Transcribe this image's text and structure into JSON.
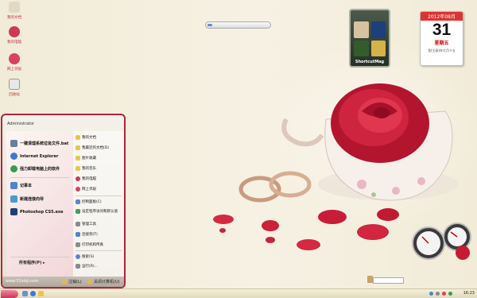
{
  "desktop": {
    "icons": [
      {
        "label": "我的文档",
        "color": "#d4c8b0"
      },
      {
        "label": "我的电脑",
        "color": "#cc3a55"
      },
      {
        "label": "网上邻居",
        "color": "#d9415f"
      },
      {
        "label": "回收站",
        "color": "#e8e8e8"
      }
    ]
  },
  "widgets": {
    "shortcut_caption": "ShortcutMag",
    "calendar": {
      "month_header": "2012年08月",
      "day": "31",
      "weekday": "星期五",
      "lunar": "龙(壬辰)年七月十五"
    }
  },
  "start_menu": {
    "user": "Administrator",
    "left_items": [
      {
        "label": "一键清理系统垃圾文件.bat",
        "color": "#6a7f9a"
      },
      {
        "label": "Internet Explorer",
        "color": "#3b7bd6"
      },
      {
        "label": "强力卸载电脑上的软件",
        "color": "#3b9a4c"
      },
      {
        "label": "记事本",
        "color": "#4a86c8"
      },
      {
        "label": "新建连接向导",
        "color": "#4a9ad0"
      },
      {
        "label": "Photoshop CS5.exe",
        "color": "#1d3f7a"
      }
    ],
    "all_programs": "所有程序(P)",
    "right_items": [
      {
        "label": "我的文档",
        "color": "#e7c64a"
      },
      {
        "label": "我最近的文档(D)",
        "color": "#e7c64a"
      },
      {
        "label": "图片收藏",
        "color": "#e7c64a"
      },
      {
        "label": "我的音乐",
        "color": "#e7c64a"
      },
      {
        "label": "我的电脑",
        "color": "#cc3a55"
      },
      {
        "label": "网上邻居",
        "color": "#d9415f"
      },
      {
        "label": "控制面板(C)",
        "color": "#5a86c8"
      },
      {
        "label": "设定程序访问和默认值",
        "color": "#4a9a5a"
      },
      {
        "label": "管理工具",
        "color": "#8a8a8a"
      },
      {
        "label": "连接到(T)",
        "color": "#4a86c8"
      },
      {
        "label": "打印机和传真",
        "color": "#8a8a8a"
      },
      {
        "label": "搜索(S)",
        "color": "#5a86c8"
      },
      {
        "label": "运行(R)...",
        "color": "#8a8a8a"
      }
    ],
    "footer": {
      "url": "www.51xtzj.com",
      "logoff": "注销(L)",
      "shutdown": "关闭计算机(U)"
    }
  },
  "taskbar": {
    "clock": "16:23"
  }
}
